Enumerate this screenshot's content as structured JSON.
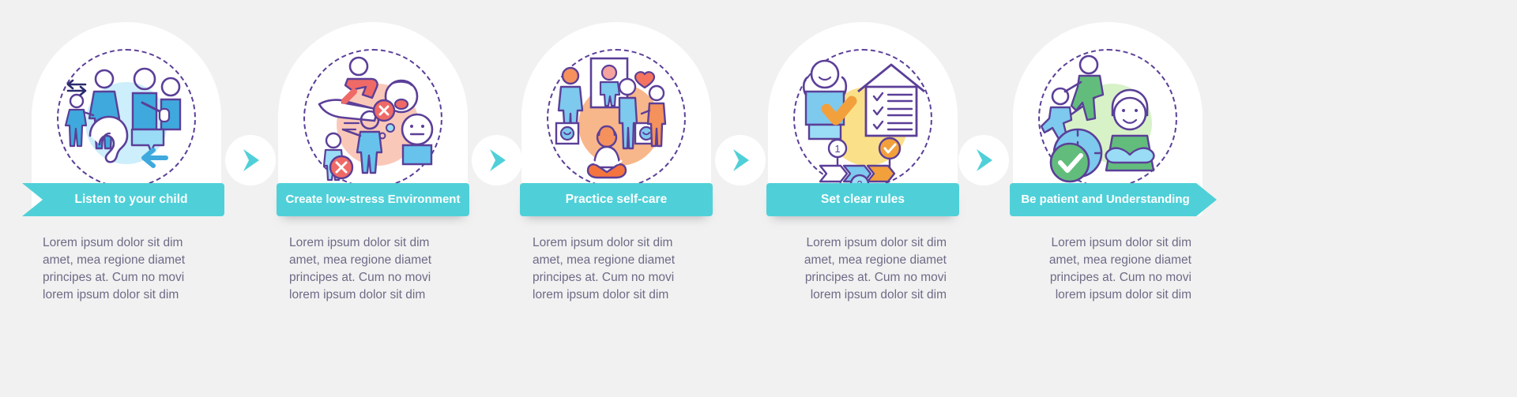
{
  "background_color": "#f1f1f1",
  "accent_color": "#4fd0d8",
  "text_color": "#6f6a86",
  "banner_text_color": "#ffffff",
  "body_paragraph": "Lorem ipsum dolor sit dim amet, mea regione diamet principes at. Cum no movi lorem ipsum dolor sit dim",
  "steps": [
    {
      "index": 1,
      "label": "Listen to your child",
      "body": "Lorem ipsum dolor sit dim amet, mea regione diamet principes at. Cum no movi lorem ipsum dolor sit dim",
      "banner_shape": "arrow-tail-left",
      "icon": "listen-to-child-icon",
      "illustration_colors": [
        "#d6f2fb",
        "#38a8e0",
        "#5b3f98",
        "#8fd8f2"
      ]
    },
    {
      "index": 2,
      "label": "Create low-stress Environment",
      "body": "Lorem ipsum dolor sit dim amet, mea regione diamet principes at. Cum no movi lorem ipsum dolor sit dim",
      "banner_shape": "rectangle",
      "icon": "low-stress-environment-icon",
      "illustration_colors": [
        "#fac6b8",
        "#ef6a66",
        "#5b3f98",
        "#7ec9ee"
      ]
    },
    {
      "index": 3,
      "label": "Practice self-care",
      "body": "Lorem ipsum dolor sit dim amet, mea regione diamet principes at. Cum no movi lorem ipsum dolor sit dim",
      "banner_shape": "rectangle",
      "icon": "practice-self-care-icon",
      "illustration_colors": [
        "#f8b78a",
        "#f47b52",
        "#5b3f98",
        "#7ec9ee"
      ]
    },
    {
      "index": 4,
      "label": "Set clear rules",
      "body": "Lorem ipsum dolor sit dim amet, mea regione diamet principes at. Cum no movi lorem ipsum dolor sit dim",
      "banner_shape": "rectangle",
      "icon": "set-clear-rules-icon",
      "illustration_colors": [
        "#fbe08a",
        "#f2a03c",
        "#5b3f98",
        "#7ec9ee"
      ]
    },
    {
      "index": 5,
      "label": "Be patient and Understanding",
      "body": "Lorem ipsum dolor sit dim amet, mea regione diamet principes at. Cum no movi lorem ipsum dolor sit dim",
      "banner_shape": "arrow-head-right",
      "icon": "be-patient-understanding-icon",
      "illustration_colors": [
        "#d8f2c8",
        "#62bd7c",
        "#5b3f98",
        "#7ec9ee"
      ]
    }
  ],
  "connectors": [
    {
      "index": 1,
      "icon": "chevron-right-icon"
    },
    {
      "index": 2,
      "icon": "chevron-right-icon"
    },
    {
      "index": 3,
      "icon": "chevron-right-icon"
    },
    {
      "index": 4,
      "icon": "chevron-right-icon"
    }
  ]
}
